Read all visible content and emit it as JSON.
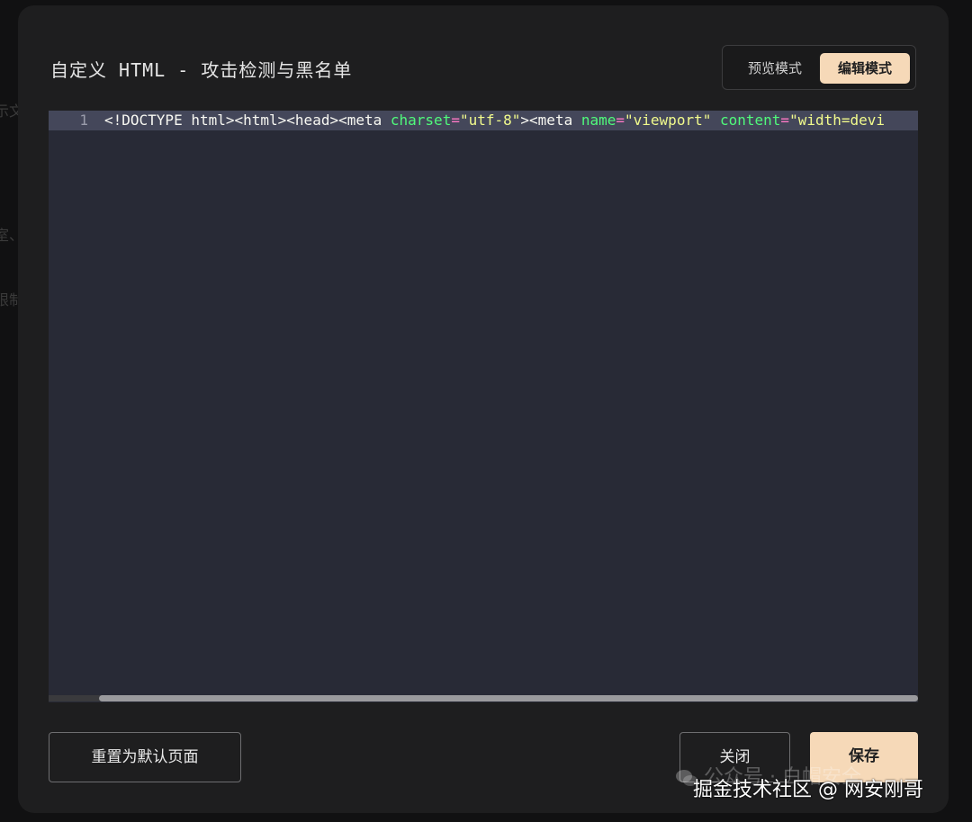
{
  "background": {
    "fragments": [
      "示文",
      "室、",
      "限制"
    ]
  },
  "dialog": {
    "title": "自定义 HTML - 攻击检测与黑名单",
    "modes": {
      "preview": "预览模式",
      "edit": "编辑模式",
      "active": "edit"
    },
    "editor": {
      "line_number": "1",
      "code_tokens": [
        {
          "t": "tag",
          "v": "<!DOCTYPE html><html><head><meta "
        },
        {
          "t": "attr",
          "v": "charset"
        },
        {
          "t": "op",
          "v": "="
        },
        {
          "t": "str",
          "v": "\"utf-8\""
        },
        {
          "t": "tag",
          "v": "><meta "
        },
        {
          "t": "attr",
          "v": "name"
        },
        {
          "t": "op",
          "v": "="
        },
        {
          "t": "str",
          "v": "\"viewport\""
        },
        {
          "t": "tag",
          "v": " "
        },
        {
          "t": "attr",
          "v": "content"
        },
        {
          "t": "op",
          "v": "="
        },
        {
          "t": "str",
          "v": "\"width=devi"
        }
      ]
    },
    "buttons": {
      "reset": "重置为默认页面",
      "close": "关闭",
      "save": "保存"
    }
  },
  "watermarks": {
    "faint": "公众号 · 白帽安全",
    "main": "掘金技术社区 @ 网安刚哥"
  },
  "colors": {
    "accent": "#f6d9b8",
    "editor_bg": "#282a36",
    "modal_bg": "#1e1e1f"
  }
}
